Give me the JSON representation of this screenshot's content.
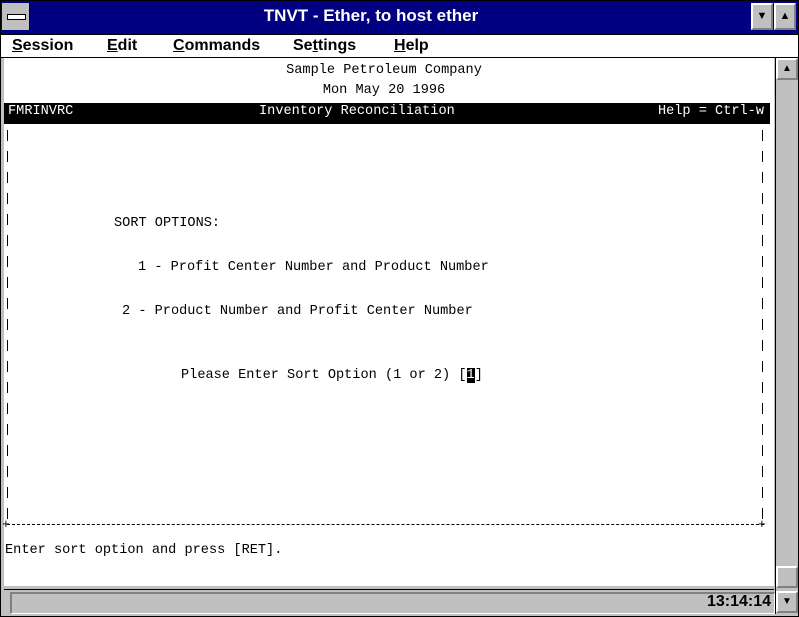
{
  "window": {
    "title": "TNVT - Ether, to host ether",
    "minimize_glyph": "▼",
    "maximize_glyph": "▲"
  },
  "menu": [
    {
      "label": "Session",
      "mnemonic": "S",
      "rest": "ession"
    },
    {
      "label": "Edit",
      "mnemonic": "E",
      "rest": "dit"
    },
    {
      "label": "Commands",
      "mnemonic": "C",
      "rest": "ommands"
    },
    {
      "label": "Settings",
      "prefix": "Se",
      "mnemonic": "t",
      "rest": "tings"
    },
    {
      "label": "Help",
      "mnemonic": "H",
      "rest": "elp"
    }
  ],
  "terminal": {
    "company": "Sample Petroleum Company",
    "date": "Mon May 20 1996",
    "screen_id": "FMRINVRC",
    "screen_title": "Inventory Reconciliation",
    "help_hint": "Help = Ctrl-w",
    "sort_heading": "SORT OPTIONS:",
    "option_1": "1 - Profit Center Number and Product Number",
    "option_2": "2 - Product Number and Profit Center Number",
    "prompt": "Please Enter Sort Option (1 or 2) [",
    "prompt_close": "]",
    "input_value": "1",
    "message": "Enter sort option and press [RET]."
  },
  "statusbar": {
    "clock": "13:14:14"
  },
  "scrollbar": {
    "up_glyph": "▲",
    "down_glyph": "▼"
  }
}
